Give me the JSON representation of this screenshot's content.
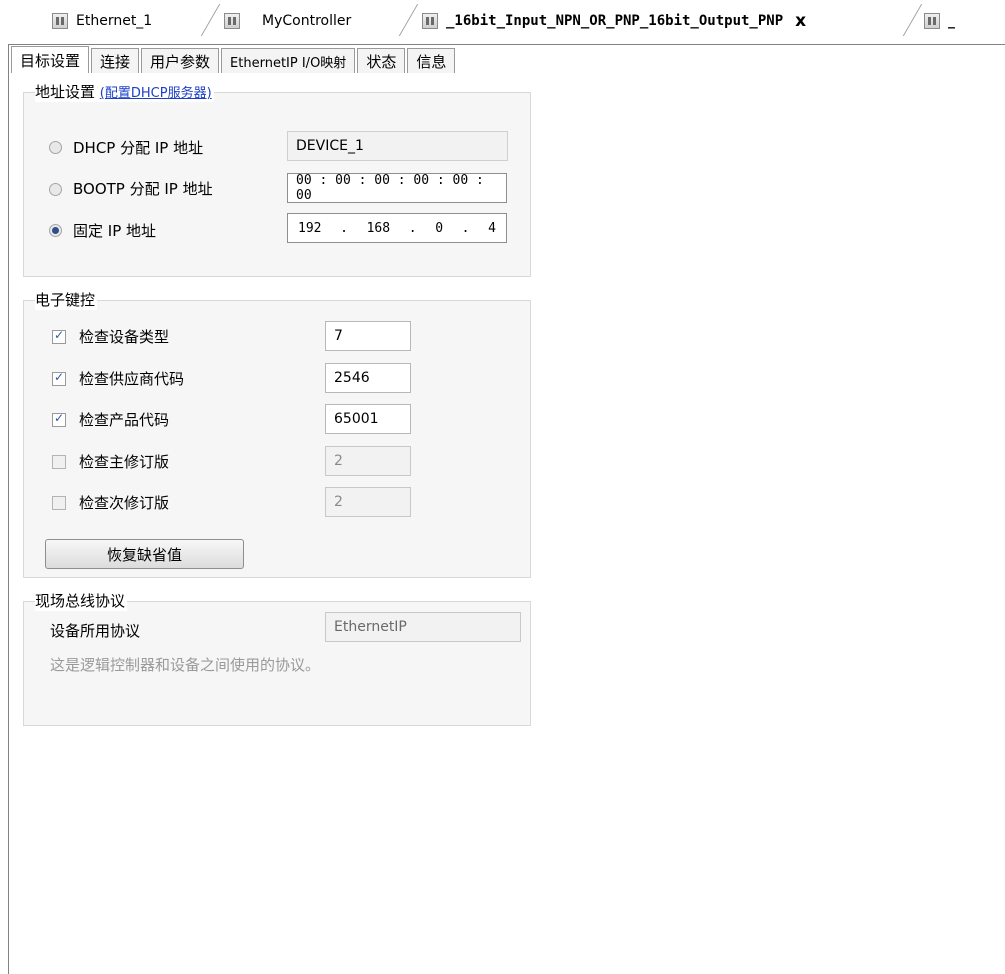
{
  "doc_tabs": [
    {
      "label": "Ethernet_1"
    },
    {
      "label": "MyController"
    },
    {
      "label": "_16bit_Input_NPN_OR_PNP_16bit_Output_PNP",
      "close": "x"
    },
    {
      "label": "_"
    }
  ],
  "sub_tabs": [
    "目标设置",
    "连接",
    "用户参数",
    "EthernetIP I/O映射",
    "状态",
    "信息"
  ],
  "address": {
    "title": "地址设置",
    "link": "(配置DHCP服务器)",
    "dhcp_label": "DHCP 分配 IP 地址",
    "dhcp_value": "DEVICE_1",
    "bootp_label": "BOOTP 分配 IP 地址",
    "bootp_value": "00 : 00 : 00 : 00 : 00 : 00",
    "fixed_label": "固定 IP 地址",
    "ip": [
      "192",
      ".",
      "168",
      ".",
      "0",
      ".",
      "4"
    ]
  },
  "keying": {
    "title": "电子键控",
    "rows": [
      {
        "label": "检查设备类型",
        "value": "7",
        "checked": true
      },
      {
        "label": "检查供应商代码",
        "value": "2546",
        "checked": true
      },
      {
        "label": "检查产品代码",
        "value": "65001",
        "checked": true
      },
      {
        "label": "检查主修订版",
        "value": "2",
        "checked": false
      },
      {
        "label": "检查次修订版",
        "value": "2",
        "checked": false
      }
    ],
    "restore_button": "恢复缺省值"
  },
  "fieldbus": {
    "title": "现场总线协议",
    "protocol_label": "设备所用协议",
    "protocol_value": "EthernetIP",
    "description": "这是逻辑控制器和设备之间使用的协议。"
  }
}
